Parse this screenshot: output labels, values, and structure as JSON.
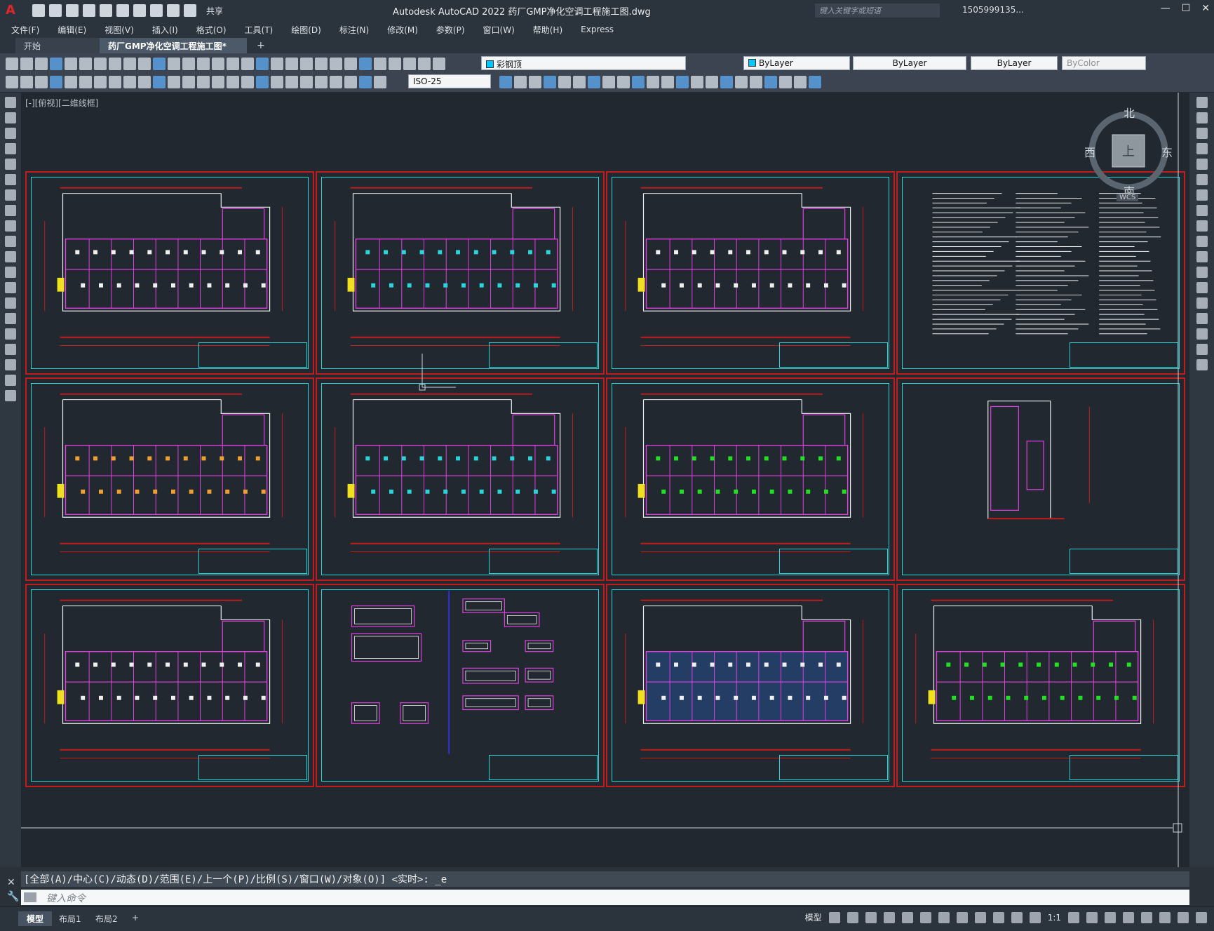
{
  "app": {
    "title": "Autodesk AutoCAD 2022    药厂GMP净化空调工程施工图.dwg",
    "share_label": "共享",
    "search_placeholder": "键入关键字或短语",
    "user": "1505999135...",
    "logo": "A"
  },
  "menu": [
    "文件(F)",
    "编辑(E)",
    "视图(V)",
    "插入(I)",
    "格式(O)",
    "工具(T)",
    "绘图(D)",
    "标注(N)",
    "修改(M)",
    "参数(P)",
    "窗口(W)",
    "帮助(H)",
    "Express"
  ],
  "tabs": {
    "start": "开始",
    "doc": "药厂GMP净化空调工程施工图*",
    "add": "+"
  },
  "toolbar": {
    "layer": "彩钢顶",
    "color": "ByLayer",
    "linetype": "ByLayer",
    "lineweight": "ByLayer",
    "plotstyle": "ByColor",
    "dimstyle": "ISO-25"
  },
  "viewport_label": "[-][俯视][二维线框]",
  "viewcube": {
    "north": "北",
    "south": "南",
    "east": "东",
    "west": "西",
    "top": "上",
    "wcs": "WCS"
  },
  "command": {
    "history": "[全部(A)/中心(C)/动态(D)/范围(E)/上一个(P)/比例(S)/窗口(W)/对象(O)] <实时>: _e",
    "placeholder": "键入命令"
  },
  "layouts": [
    "模型",
    "布局1",
    "布局2"
  ],
  "status": {
    "model": "模型",
    "scale": "1:1"
  },
  "colors": {
    "frame_red": "#c21c1c",
    "frame_cyan": "#2bd4d8",
    "magenta": "#e040e0",
    "green": "#24e024",
    "orange": "#f0a030",
    "white": "#f0f0f0"
  }
}
